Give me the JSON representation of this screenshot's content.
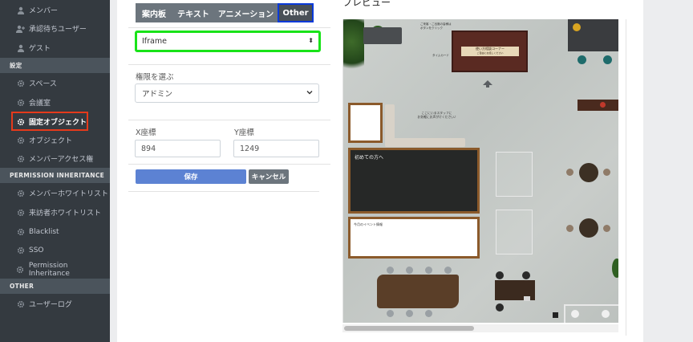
{
  "sidebar": {
    "items_top": [
      {
        "label": "メンバー",
        "icon": "user-icon"
      },
      {
        "label": "承認待ちユーザー",
        "icon": "user-plus-icon"
      },
      {
        "label": "ゲスト",
        "icon": "user-icon"
      }
    ],
    "section_settings": "設定",
    "items_settings": [
      {
        "label": "スペース",
        "icon": "gear-icon"
      },
      {
        "label": "会議室",
        "icon": "gear-icon"
      },
      {
        "label": "固定オブジェクト",
        "icon": "gear-icon"
      },
      {
        "label": "オブジェクト",
        "icon": "gear-icon"
      },
      {
        "label": "メンバーアクセス権",
        "icon": "gear-icon"
      }
    ],
    "section_permission": "PERMISSION INHERITANCE",
    "items_permission": [
      {
        "label": "メンバーホワイトリスト",
        "icon": "gear-icon"
      },
      {
        "label": "来訪者ホワイトリスト",
        "icon": "gear-icon"
      },
      {
        "label": "Blacklist",
        "icon": "gear-icon"
      },
      {
        "label": "SSO",
        "icon": "gear-icon"
      },
      {
        "label": "Permission Inheritance",
        "icon": "gear-icon"
      }
    ],
    "section_other": "OTHER",
    "items_other": [
      {
        "label": "ユーザーログ",
        "icon": "gear-icon"
      }
    ]
  },
  "tabs": [
    "案内板",
    "テキスト",
    "アニメーション",
    "Other"
  ],
  "preview": {
    "title": "プレビュー",
    "board_first_visit": "初めての方へ",
    "board_events": "今月のイベント情報",
    "sofa_note": "ここにいるスタッフに\nお気軽にお声がけください♪",
    "corner_title": "使い方相談コーナー",
    "corner_sub": "ご自由にお話しください",
    "top_note": "ご来客・ご出席の皆様は\nボタンをクリック",
    "time_label": "タイムカード"
  },
  "form": {
    "type_value": "Iframe",
    "role_label": "権限を選ぶ",
    "role_value": "アドミン",
    "x_label": "X座標",
    "x_value": "894",
    "y_label": "Y座標",
    "y_value": "1249",
    "save_label": "保存",
    "cancel_label": "キャンセル"
  },
  "colors": {
    "sidebar_bg": "#343a40",
    "highlight_red": "#e53a1b",
    "highlight_green": "#19e319",
    "highlight_blue": "#0a3ad9",
    "save_button": "#5c82d3"
  }
}
